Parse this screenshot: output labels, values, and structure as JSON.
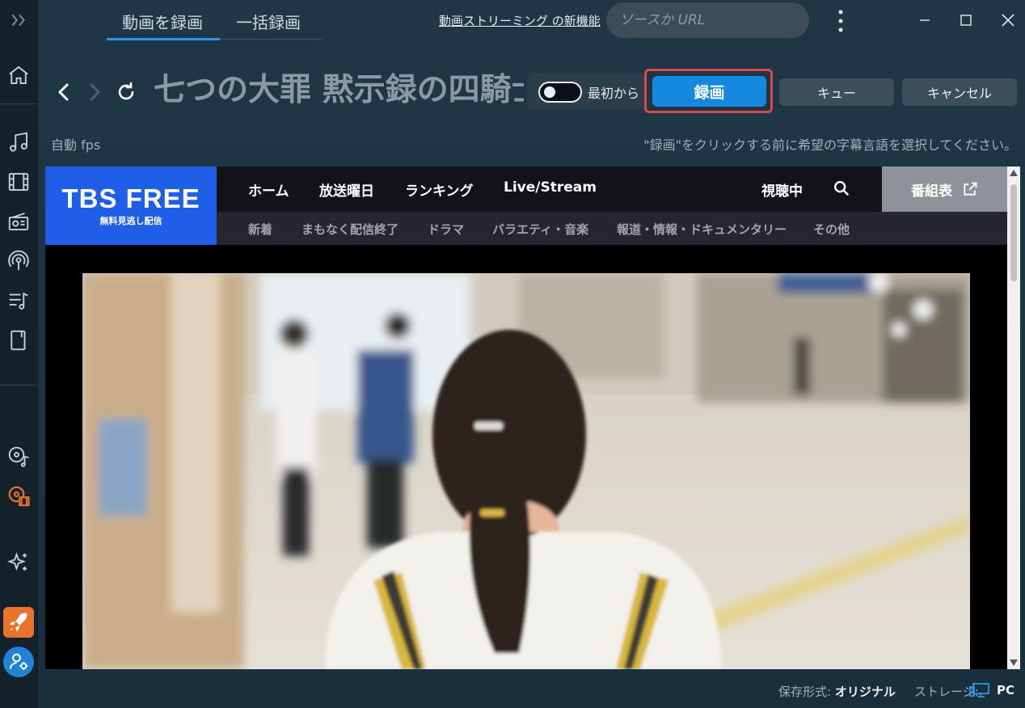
{
  "top": {
    "tabs": [
      {
        "label": "動画を録画",
        "active": true
      },
      {
        "label": "一括録画",
        "active": false
      }
    ],
    "new_feature_link": "動画ストリーミング の新機能",
    "search_placeholder": "ソースか URL"
  },
  "nav": {
    "page_title": "七つの大罪 黙示録の四騎士",
    "toggle_label": "最初から",
    "toggle_on": false,
    "record_label": "録画",
    "queue_label": "キュー",
    "cancel_label": "キャンセル"
  },
  "info": {
    "fps_label": "自動 fps",
    "hint": "\"録画\"をクリックする前に希望の字幕言語を選択してください。"
  },
  "site": {
    "logo": "TBS FREE",
    "logo_sub": "無料見逃し配信",
    "nav_primary": [
      "ホーム",
      "放送曜日",
      "ランキング",
      "Live/Stream"
    ],
    "watching": "視聴中",
    "schedule": "番組表",
    "nav_secondary": [
      "新着",
      "まもなく配信終了",
      "ドラマ",
      "バラエティ・音楽",
      "報道・情報・ドキュメンタリー",
      "その他"
    ]
  },
  "status": {
    "format_label": "保存形式:",
    "format_value": "オリジナル",
    "storage_label": "ストレージ:",
    "storage_value": "PC"
  },
  "colors": {
    "accent": "#1688e0",
    "highlight": "#e04848",
    "logo_blue": "#1f5ee6",
    "rocket": "#e8742b"
  },
  "sidebar_icons": [
    "expand-icon",
    "home-icon",
    "music-icon",
    "film-icon",
    "radio-icon",
    "podcast-icon",
    "playlist-icon",
    "ebook-icon",
    "music-recorder-icon",
    "video-recorder-icon",
    "ai-sparkle-icon",
    "rocket-icon",
    "user-settings-icon"
  ]
}
